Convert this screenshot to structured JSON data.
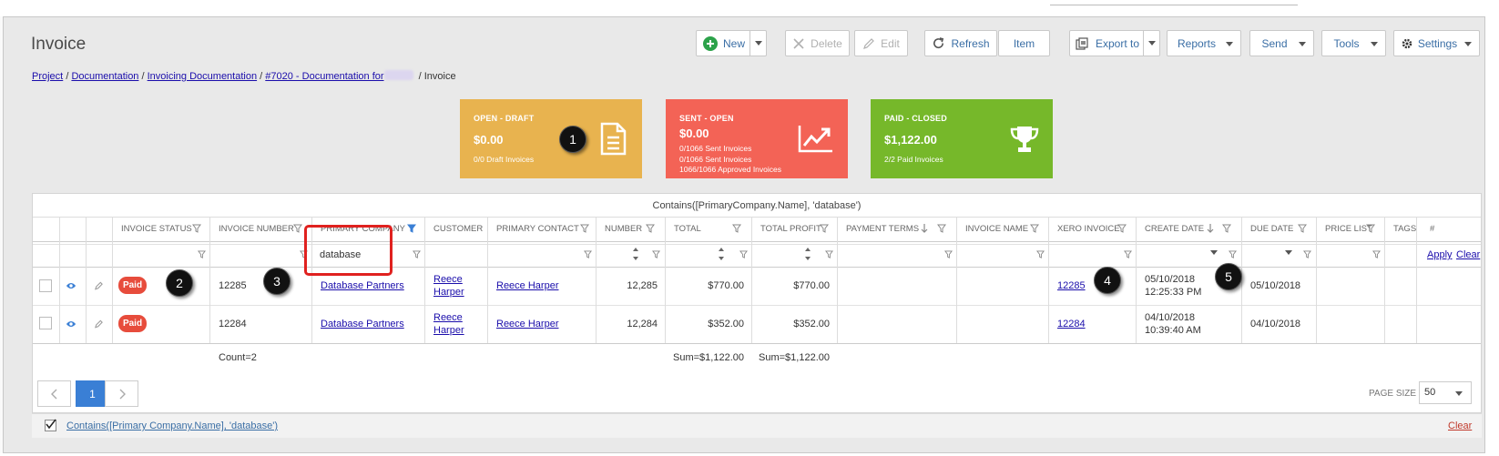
{
  "page": {
    "title": "Invoice"
  },
  "breadcrumb": {
    "items": [
      "Project",
      "Documentation",
      "Invoicing Documentation",
      "#7020 - Documentation for"
    ],
    "separator": "/",
    "current": "Invoice"
  },
  "toolbar": {
    "new": "New",
    "delete": "Delete",
    "edit": "Edit",
    "refresh": "Refresh",
    "item": "Item",
    "export": "Export to",
    "reports": "Reports",
    "send": "Send",
    "tools": "Tools",
    "settings": "Settings"
  },
  "cards": [
    {
      "title": "OPEN - DRAFT",
      "amount": "$0.00",
      "lines": [
        "0/0 Draft Invoices"
      ],
      "color": "#e8b34f",
      "icon": "document-icon"
    },
    {
      "title": "SENT - OPEN",
      "amount": "$0.00",
      "lines": [
        "0/1066 Sent Invoices",
        "0/1066 Sent Invoices",
        "1066/1066 Approved Invoices"
      ],
      "color": "#f36356",
      "icon": "trend-chart-icon"
    },
    {
      "title": "PAID - CLOSED",
      "amount": "$1,122.00",
      "lines": [
        "2/2 Paid Invoices"
      ],
      "color": "#76b82a",
      "icon": "trophy-icon"
    }
  ],
  "callouts": [
    "1",
    "2",
    "3",
    "4",
    "5"
  ],
  "grid": {
    "filter_expression": "Contains([PrimaryCompany.Name], 'database')",
    "columns": [
      "INVOICE STATUS",
      "INVOICE NUMBER",
      "PRIMARY COMPANY",
      "CUSTOMER",
      "PRIMARY CONTACT",
      "NUMBER",
      "TOTAL",
      "TOTAL PROFIT",
      "PAYMENT TERMS",
      "INVOICE NAME",
      "XERO INVOICE",
      "CREATE DATE",
      "DUE DATE",
      "PRICE LIST",
      "TAGS",
      "#"
    ],
    "filter_value": "database",
    "apply": "Apply",
    "clear": "Clear",
    "rows": [
      {
        "status": "Paid",
        "invoice_number": "12285",
        "company": "Database Partners",
        "customer_line1": "Reece",
        "customer_line2": "Harper",
        "contact": "Reece Harper",
        "number": "12,285",
        "total": "$770.00",
        "profit": "$770.00",
        "xero": "12285",
        "create_date": "05/10/2018",
        "create_time": "12:25:33 PM",
        "due_date": "05/10/2018"
      },
      {
        "status": "Paid",
        "invoice_number": "12284",
        "company": "Database Partners",
        "customer_line1": "Reece",
        "customer_line2": "Harper",
        "contact": "Reece Harper",
        "number": "12,284",
        "total": "$352.00",
        "profit": "$352.00",
        "xero": "12284",
        "create_date": "04/10/2018",
        "create_time": "10:39:40 AM",
        "due_date": "04/10/2018"
      }
    ],
    "summary": {
      "count": "Count=2",
      "total_sum": "Sum=$1,122.00",
      "profit_sum": "Sum=$1,122.00"
    }
  },
  "pager": {
    "current_page": "1",
    "page_size_label": "PAGE SIZE",
    "page_size": "50"
  },
  "footer": {
    "filter_text": "Contains([Primary Company.Name], 'database')",
    "clear": "Clear"
  },
  "colors": {
    "accent": "#3a7fd5",
    "link": "#1a0dab",
    "paid_badge": "#e74c3c",
    "highlight": "#e0211f",
    "new_icon": "#2ca24a"
  }
}
